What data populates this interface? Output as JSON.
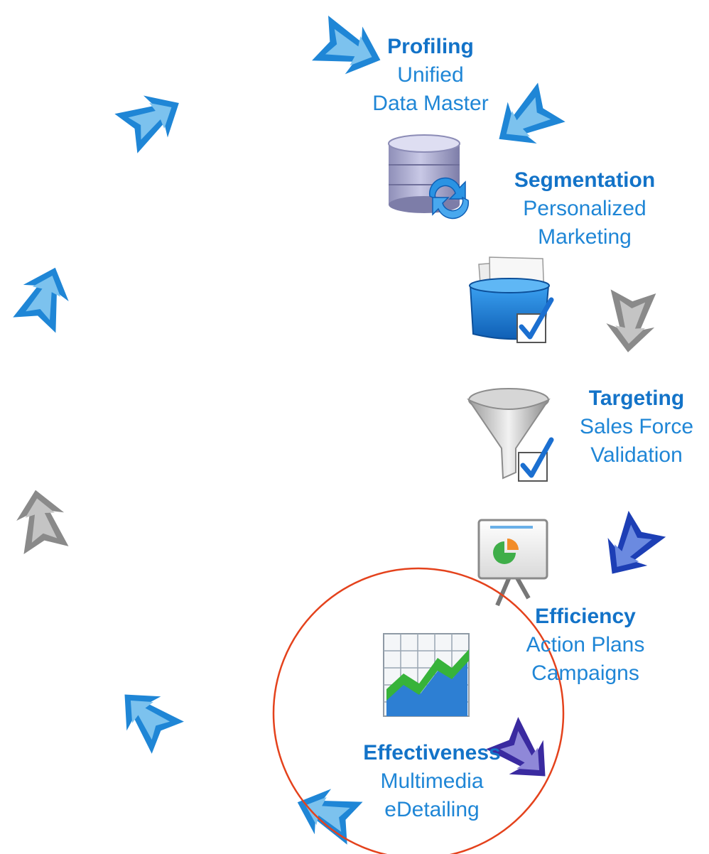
{
  "colors": {
    "text": "#1f86d6",
    "title": "#1373c8",
    "arrow_blue": "#1f86d6",
    "arrow_blue_fill": "#7cc2ee",
    "arrow_gray": "#8a8a8a",
    "arrow_gray_fill": "#c4c4c4",
    "arrow_navy": "#1d3fb5",
    "arrow_navy_fill": "#6b8ae0",
    "arrow_purple": "#3a2aa0",
    "arrow_purple_fill": "#8f88d8",
    "circle": "#e4421c"
  },
  "stages": [
    {
      "title": "Profiling",
      "lines": [
        "Unified",
        "Data Master"
      ],
      "icon": "database-sync-icon"
    },
    {
      "title": "Segmentation",
      "lines": [
        "Personalized",
        "Marketing"
      ],
      "icon": "folder-box-check-icon"
    },
    {
      "title": "Targeting",
      "lines": [
        "Sales Force",
        "Validation"
      ],
      "icon": "funnel-check-icon"
    },
    {
      "title": "Efficiency",
      "lines": [
        "Action Plans",
        "Campaigns"
      ],
      "icon": "presentation-board-icon"
    },
    {
      "title": "Effectiveness",
      "lines": [
        "Multimedia",
        "eDetailing"
      ],
      "icon": "chart-growth-icon"
    }
  ],
  "arrows": [
    {
      "name": "arrow-into-profiling",
      "style": "blue"
    },
    {
      "name": "arrow-profiling-to-segmentation",
      "style": "blue"
    },
    {
      "name": "arrow-segmentation-to-targeting",
      "style": "gray"
    },
    {
      "name": "arrow-targeting-to-efficiency",
      "style": "navy"
    },
    {
      "name": "arrow-efficiency-to-effectiveness",
      "style": "purple"
    },
    {
      "name": "arrow-effectiveness-out",
      "style": "blue"
    },
    {
      "name": "arrow-cycle-lower-left",
      "style": "blue"
    },
    {
      "name": "arrow-cycle-left-gray",
      "style": "gray"
    },
    {
      "name": "arrow-cycle-left-upper",
      "style": "blue"
    },
    {
      "name": "arrow-cycle-top-left",
      "style": "blue"
    }
  ],
  "highlight": {
    "target": "Effectiveness",
    "shape": "circle"
  }
}
